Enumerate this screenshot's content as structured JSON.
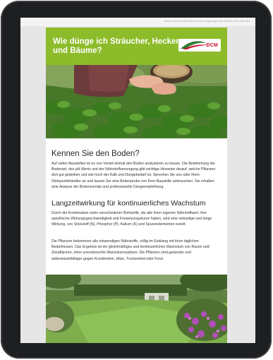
{
  "preheader": {
    "link_text": "Wenn diese E-Mail nicht korrekt angezeigt wird, klicken Sie bitte hier"
  },
  "header": {
    "title": "Wie dünge ich Sträucher, Hecken und Bäume?",
    "logo_text": "DCM",
    "brand_green": "#8cbc29",
    "brand_red": "#c8102e"
  },
  "hero": {
    "icon": "hands-spreading-fertilizer-image"
  },
  "section1": {
    "heading": "Kennen Sie den Boden?",
    "paragraph": "Auf vielen Baustellen ist es von Vorteil einmal den Boden analysieren zu lassen. Die Bestimmung der Bodenart, des pH-Werts und der Nährstoffversorgung gibt wichtige Hinweise darauf, welche Pflanzen dort gut gedeihen und wie hoch der Kalk und Düngebedarf ist. Sprechen Sie uns oder Ihren Stützpunkthändler an und lassen Sie eine Bodenprobe von Ihrer Baustelle untersuchen. Sie erhalten eine Analyse der Bodenvorräte und professionelle Düngeempfehlung."
  },
  "section2": {
    "heading": "Langzeitwirkung für kontinuierliches Wachstum",
    "paragraph1": "Durch die Kombination vieler verschiedener Rohstoffe, die alle ihren eigenen Nährstoffwert, ihre spezifische Wirkungsgeschwindigkeit und Freisetzungskurve haben, wird eine vielseitige und lange Wirkung, von Stickstoff (N), Phosphor (P), Kalium (K) und Spurenelementen erzielt.",
    "paragraph2": "Die Pflanzen bekommen alle notwendigen Nährstoffe, völlig im Einklang mit ihren täglichen Bedürfnissen. Das Ergebnis ist ein gleichmäßiges und kontinuierliches Wachstum von Rasen und Zierpflanzen, ohne unerwünschte Wachstumsspitzen. Die Pflanzen sind gesünder und widerstandsfähiger gegen Krankheiten, Hitze, Trockenheit oder Frost."
  },
  "garden": {
    "icon": "garden-lawn-image"
  }
}
